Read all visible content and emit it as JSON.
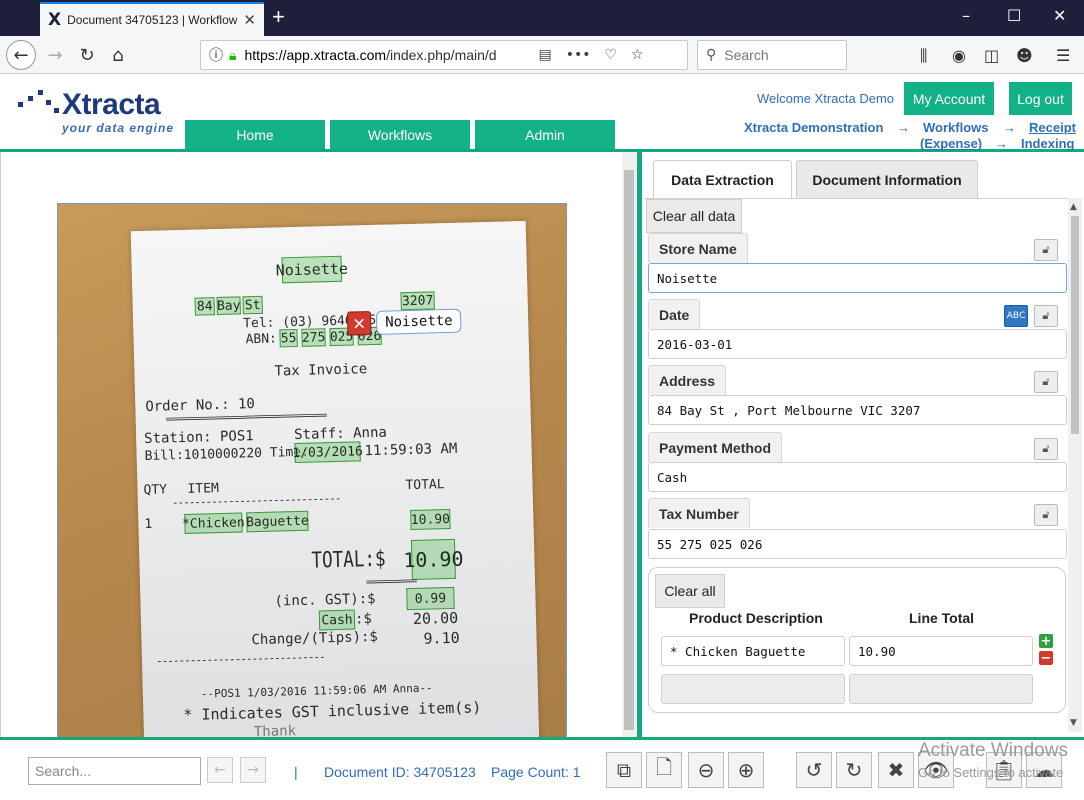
{
  "browser": {
    "tab_title": "Document 34705123 | Workflow",
    "favicon_letter": "X",
    "url_host": "https://app.xtracta.com",
    "url_path": "/index.php/main/d",
    "search_placeholder": "Search",
    "window_controls": [
      "–",
      "☐",
      "✕"
    ]
  },
  "header": {
    "logo_name": "Xtracta",
    "logo_tagline": "your data engine",
    "menu": [
      "Home",
      "Workflows",
      "Admin"
    ],
    "welcome": "Welcome Xtracta Demo",
    "my_account": "My Account",
    "logout": "Log out",
    "breadcrumb": {
      "a": "Xtracta Demonstration",
      "b": "Workflows",
      "c1": "Receipt",
      "c2": "(Expense)",
      "d": "Indexing",
      "arrow": "→"
    },
    "brand_color": "#12b187"
  },
  "receipt": {
    "store": "Noisette",
    "address_tokens": [
      "84",
      "Bay",
      "St"
    ],
    "postcode": "3207",
    "address_hidden": "VIC",
    "tel": "Tel: (03) 9646 9555",
    "abn_label": "ABN:",
    "abn_parts": [
      "55",
      "275",
      "025",
      "026"
    ],
    "title": "Tax Invoice",
    "order": "Order No.: 10",
    "separator": "================================",
    "station": "Station: POS1",
    "staff": "Staff: Anna",
    "bill": "Bill:1010000220 Time:",
    "bill_date": "1/03/2016",
    "bill_time": "11:59:03 AM",
    "col_qty": "QTY",
    "col_item": "ITEM",
    "col_total": "TOTAL",
    "dashes": "------------------------------",
    "line_qty": "1",
    "line_item_a": "*Chicken",
    "line_item_b": "Baguette",
    "line_total": "10.90",
    "total_label": "TOTAL:$",
    "total_value": "10.90",
    "gst_label": "(inc. GST):$",
    "gst_value": "0.99",
    "cash_label": "Cash",
    "cash_suffix": ":$",
    "cash_value": "20.00",
    "change_label": "Change/(Tips):$",
    "change_value": "9.10",
    "footer_line": "--POS1 1/03/2016 11:59:06 AM Anna--",
    "gst_note": "* Indicates GST inclusive item(s)",
    "thanks_partial": "Thank",
    "popup_value": "Noisette",
    "popup_close": "✕"
  },
  "panel": {
    "tabs": [
      "Data Extraction",
      "Document Information"
    ],
    "clear_all_data": "Clear all data",
    "fields": [
      {
        "label": "Store Name",
        "value": "Noisette"
      },
      {
        "label": "Date",
        "value": "2016-03-01"
      },
      {
        "label": "Address",
        "value": "84 Bay St , Port Melbourne VIC 3207"
      },
      {
        "label": "Payment Method",
        "value": "Cash"
      },
      {
        "label": "Tax Number",
        "value": "55 275 025 026"
      }
    ],
    "spell_icon": "ABC",
    "line_items": {
      "clear_all": "Clear all",
      "col_desc": "Product Description",
      "col_total": "Line Total",
      "rows": [
        {
          "desc": "* Chicken Baguette",
          "total": "10.90"
        }
      ]
    }
  },
  "footer": {
    "search_placeholder": "Search...",
    "separator": "|",
    "document_id": "Document ID: 34705123",
    "page_count": "Page Count: 1",
    "watermark_title": "Activate Windows",
    "watermark_sub": "Go to Settings to activate"
  }
}
